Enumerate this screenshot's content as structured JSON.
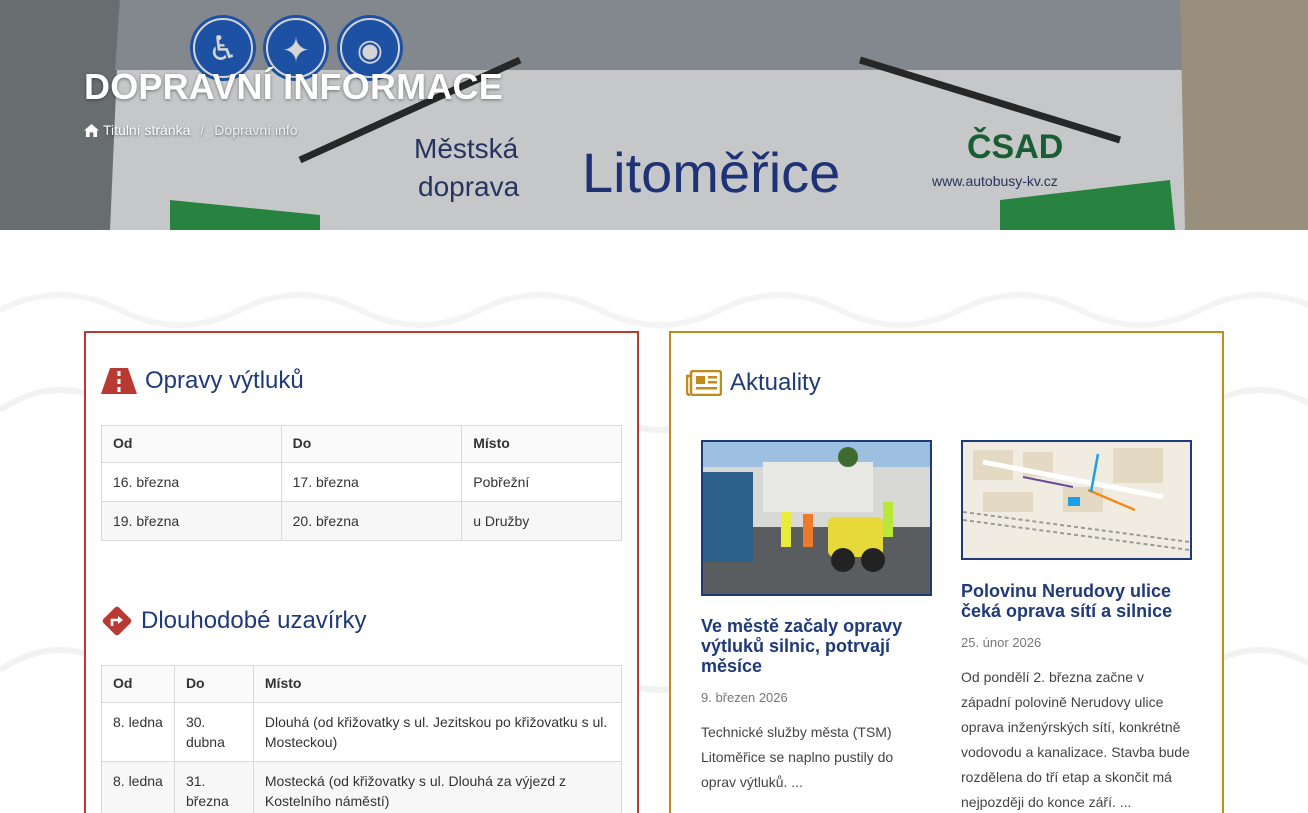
{
  "hero": {
    "title": "DOPRAVNÍ INFORMACE",
    "bus_text": {
      "line1": "Městská",
      "line2": "doprava",
      "brand": "Litoměřice",
      "web": "www.autobusy-kv.cz",
      "logo": "ČSAD"
    }
  },
  "breadcrumb": {
    "home_label": "Titulní stránka",
    "separator": "/",
    "current": "Dopravní info"
  },
  "repairs": {
    "title": "Opravy výtluků",
    "icon": "road-icon",
    "accent": "#b93a32",
    "columns": [
      "Od",
      "Do",
      "Místo"
    ],
    "rows": [
      [
        "16. března",
        "17. března",
        "Pobřežní"
      ],
      [
        "19. března",
        "20. března",
        "u Družby"
      ]
    ]
  },
  "closures": {
    "title": "Dlouhodobé uzavírky",
    "icon": "detour-sign-icon",
    "columns": [
      "Od",
      "Do",
      "Místo"
    ],
    "rows": [
      [
        "8. ledna",
        "30. dubna",
        "Dlouhá (od křižovatky s ul. Jezitskou po křižovatku s ul. Mosteckou)"
      ],
      [
        "8. ledna",
        "31. března",
        "Mostecká (od křižovatky s ul. Dlouhá za výjezd z Kostelního náměstí)"
      ]
    ]
  },
  "news": {
    "title": "Aktuality",
    "icon": "newspaper-icon",
    "accent": "#c08b1a",
    "items": [
      {
        "title": "Ve městě začaly opravy výtluků silnic, potrvají měsíce",
        "date": "9. březen 2026",
        "text": "Technické služby města (TSM) Litoměřice se naplno pustily do oprav výtluků. ..."
      },
      {
        "title": "Polovinu Nerudovy ulice čeká oprava sítí a silnice",
        "date": "25. únor 2026",
        "text": "Od pondělí 2. března začne v západní polovině Nerudovy ulice oprava inženýrských sítí, konkrétně vodovodu a kanalizace. Stavba bude rozdělena do tří etap a skončit má nejpozději do konce září. ..."
      }
    ]
  },
  "colors": {
    "title_blue": "#1f3a78",
    "panel_red": "#b93a32",
    "panel_gold": "#c08b1a",
    "accessibility_blue": "#1f5fc4"
  }
}
